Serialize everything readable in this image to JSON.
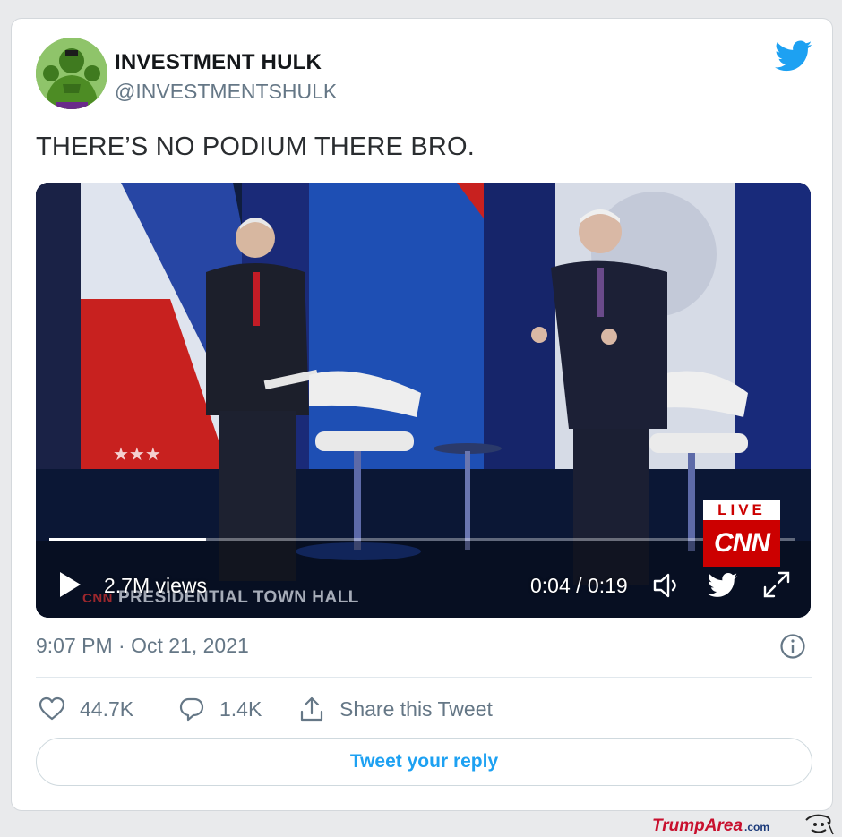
{
  "author": {
    "name": "INVESTMENT HULK",
    "handle": "@INVESTMENTSHULK",
    "avatar_icon": "hulk-avatar"
  },
  "tweet": {
    "text": "THERE’S NO PODIUM THERE BRO.",
    "timestamp": "9:07 PM · Oct 21, 2021"
  },
  "media": {
    "views": "2.7M views",
    "time": "0:04 / 0:19",
    "progress_fraction": 0.21,
    "chyron_brand": "CNN",
    "chyron_text": "PRESIDENTIAL TOWN HALL",
    "live_label": "LIVE",
    "network_logo": "CNN"
  },
  "actions": {
    "likes": "44.7K",
    "replies": "1.4K",
    "share_label": "Share this Tweet"
  },
  "reply_button": "Tweet your reply",
  "watermark": {
    "brand": "TrumpArea",
    "suffix": ".com"
  },
  "colors": {
    "twitter_blue": "#1da1f2",
    "cnn_red": "#cc0000",
    "secondary_text": "#657786"
  }
}
